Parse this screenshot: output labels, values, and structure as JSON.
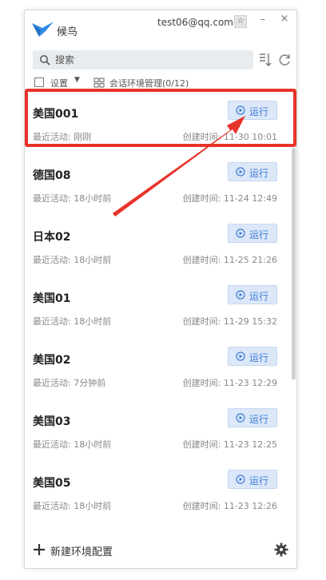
{
  "app": {
    "name": "候鸟",
    "account": "test06@qq.com"
  },
  "window": {
    "pin_glyph": "☆",
    "minimize_glyph": "–",
    "close_glyph": "×"
  },
  "search": {
    "placeholder": "搜索"
  },
  "toolbar": {
    "settings_label": "设置",
    "caret": "▼",
    "manage_label": "会话环境管理(0/12)"
  },
  "run_label": "运行",
  "items": [
    {
      "name": "美国001",
      "activity": "最近活动: 刚刚",
      "created": "创建时间: 11-30 10:01"
    },
    {
      "name": "德国08",
      "activity": "最近活动: 18小时前",
      "created": "创建时间: 11-24 12:49"
    },
    {
      "name": "日本02",
      "activity": "最近活动: 18小时前",
      "created": "创建时间: 11-25 21:26"
    },
    {
      "name": "美国01",
      "activity": "最近活动: 18小时前",
      "created": "创建时间: 11-29 15:32"
    },
    {
      "name": "美国02",
      "activity": "最近活动: 7分钟前",
      "created": "创建时间: 11-23 12:29"
    },
    {
      "name": "美国03",
      "activity": "最近活动: 18小时前",
      "created": "创建时间: 11-23 12:25"
    },
    {
      "name": "美国05",
      "activity": "最近活动: 18小时前",
      "created": "创建时间: 11-23 12:26"
    }
  ],
  "footer": {
    "new_label": "新建环境配置"
  },
  "colors": {
    "accent": "#3d7bd9",
    "annotation": "#e8332a",
    "run_bg": "#dce8f8"
  },
  "icons": [
    "bird-logo-icon",
    "pin-icon",
    "search-icon",
    "sort-icon",
    "refresh-icon",
    "grid-icon",
    "play-icon",
    "plus-icon",
    "gear-icon",
    "arrow-annotation"
  ]
}
